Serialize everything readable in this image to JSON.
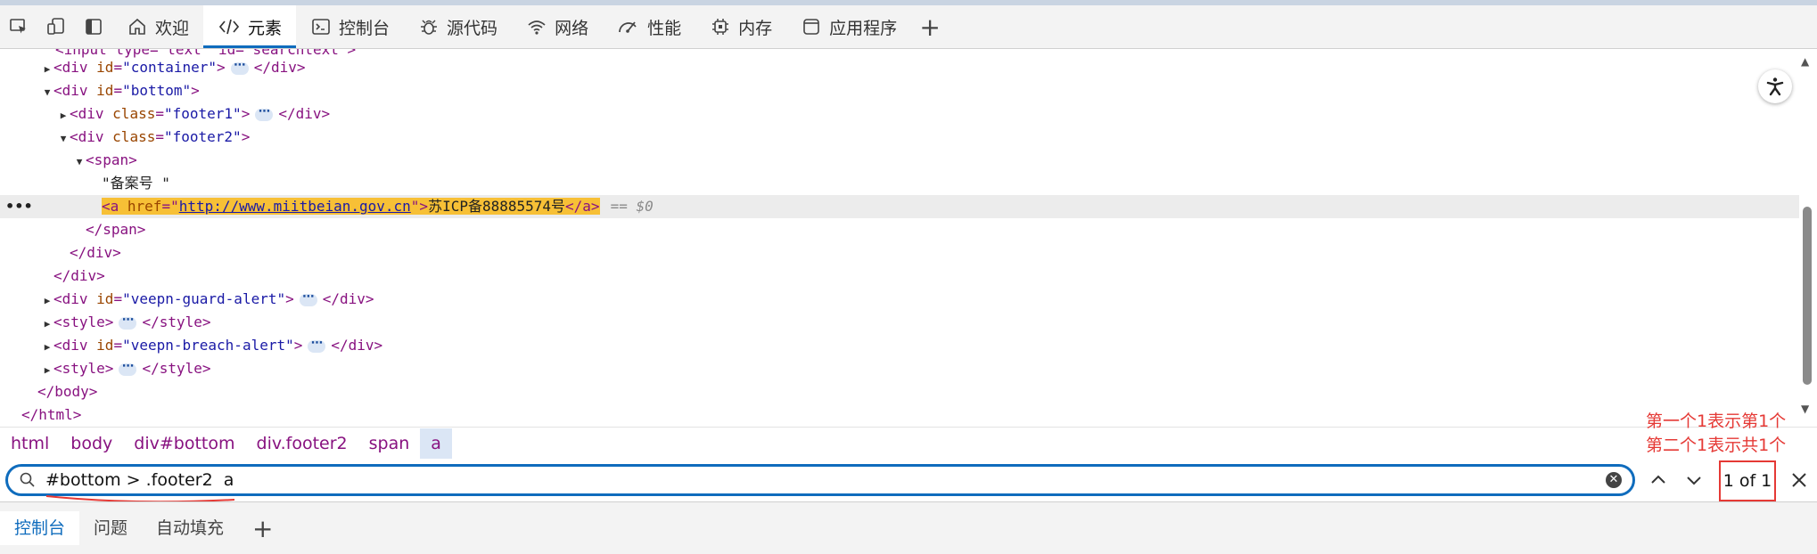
{
  "toolbar": {
    "tabs": [
      {
        "label": "欢迎",
        "icon": "home-icon"
      },
      {
        "label": "元素",
        "icon": "code-icon"
      },
      {
        "label": "控制台",
        "icon": "console-icon"
      },
      {
        "label": "源代码",
        "icon": "bug-icon"
      },
      {
        "label": "网络",
        "icon": "wifi-icon"
      },
      {
        "label": "性能",
        "icon": "gauge-icon"
      },
      {
        "label": "内存",
        "icon": "chip-icon"
      },
      {
        "label": "应用程序",
        "icon": "window-icon"
      }
    ],
    "active_tab": "元素",
    "add_tab": "+"
  },
  "dom": {
    "line0": {
      "text": "<input type=\"text\" id=\"searchtext\">"
    },
    "line1": {
      "open": "<div ",
      "attr": "id",
      "eq": "=",
      "val": "\"container\"",
      "close": ">",
      "end": "</div>"
    },
    "line2": {
      "open": "<div ",
      "attr": "id",
      "eq": "=",
      "val": "\"bottom\"",
      "close": ">"
    },
    "line3": {
      "open": "<div ",
      "attr": "class",
      "eq": "=",
      "val": "\"footer1\"",
      "close": ">",
      "end": "</div>"
    },
    "line4": {
      "open": "<div ",
      "attr": "class",
      "eq": "=",
      "val": "\"footer2\"",
      "close": ">"
    },
    "line5": {
      "open": "<span>"
    },
    "line6": {
      "text": "\"备案号 \""
    },
    "line7": {
      "open": "<a ",
      "attr": "href",
      "eq": "=\"",
      "link": "http://www.miitbeian.gov.cn",
      "q": "\">",
      "txt": "苏ICP备88885574号",
      "end": "</a>",
      "dollar": "== $0"
    },
    "line8": {
      "end": "</span>"
    },
    "line9": {
      "end": "</div>"
    },
    "line10": {
      "end": "</div>"
    },
    "line11": {
      "open": "<div ",
      "attr": "id",
      "eq": "=",
      "val": "\"veepn-guard-alert\"",
      "close": ">",
      "end": "</div>"
    },
    "line12": {
      "open": "<style>",
      "end": "</style>"
    },
    "line13": {
      "open": "<div ",
      "attr": "id",
      "eq": "=",
      "val": "\"veepn-breach-alert\"",
      "close": ">",
      "end": "</div>"
    },
    "line14": {
      "open": "<style>",
      "end": "</style>"
    },
    "line15": {
      "end": "</body>"
    },
    "line16": {
      "end": "</html>"
    },
    "ellipsis": "⋯",
    "row_dots": "•••"
  },
  "breadcrumb": [
    "html",
    "body",
    "div#bottom",
    "div.footer2",
    "span",
    "a"
  ],
  "annotations": {
    "line1": "第一个1表示第1个",
    "line2": "第二个1表示共1个"
  },
  "search": {
    "value": "#bottom > .footer2  a",
    "match_count": "1 of 1"
  },
  "drawer": {
    "tabs": [
      "控制台",
      "问题",
      "自动填充"
    ],
    "active_tab": "控制台",
    "add": "+"
  }
}
